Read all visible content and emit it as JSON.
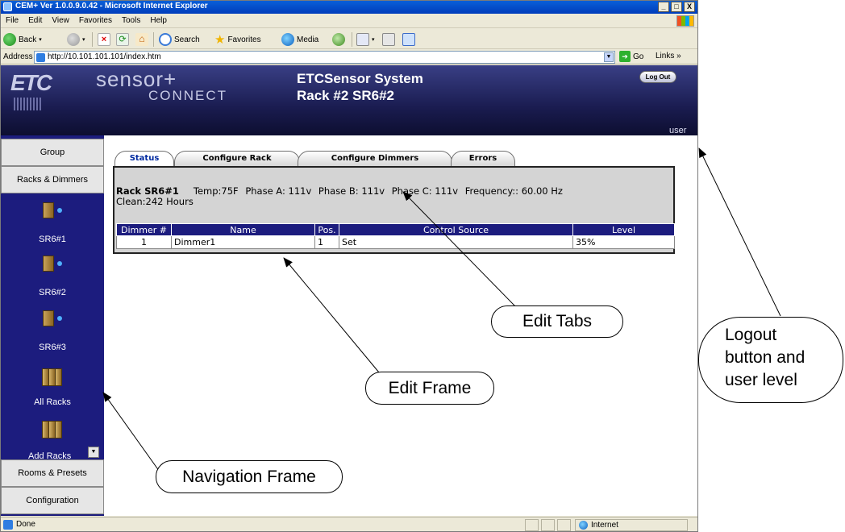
{
  "window": {
    "title": "CEM+ Ver 1.0.0.9.0.42 - Microsoft Internet Explorer",
    "min": "_",
    "max": "□",
    "close": "X"
  },
  "menu": [
    "File",
    "Edit",
    "View",
    "Favorites",
    "Tools",
    "Help"
  ],
  "toolbar": {
    "back": "Back",
    "search": "Search",
    "favorites": "Favorites",
    "media": "Media"
  },
  "address": {
    "label": "Address",
    "url": "http://10.101.101.101/index.htm",
    "go": "Go",
    "links": "Links"
  },
  "header": {
    "brand_main": "sensor+",
    "brand_sub": "CONNECT",
    "system_title": "ETCSensor System",
    "rack_title": "Rack #2 SR6#2",
    "logout": "Log Out",
    "user": "user"
  },
  "nav": {
    "group": "Group",
    "racks_dimmers": "Racks & Dimmers",
    "racks": [
      "SR6#1",
      "SR6#2",
      "SR6#3"
    ],
    "all_racks": "All Racks",
    "add_racks": "Add Racks",
    "rooms_presets": "Rooms & Presets",
    "configuration": "Configuration"
  },
  "tabs": [
    "Status",
    "Configure Rack",
    "Configure Dimmers",
    "Errors"
  ],
  "rack_info": {
    "name": "Rack SR6#1",
    "temp": "Temp:75F",
    "phase_a": "Phase A: 111v",
    "phase_b": "Phase B: 111v",
    "phase_c": "Phase C: 111v",
    "frequency": "Frequency:: 60.00 Hz",
    "clean": "Clean:242 Hours"
  },
  "table": {
    "headers": [
      "Dimmer #",
      "Name",
      "Pos.",
      "Control Source",
      "Level"
    ],
    "rows": [
      [
        "1",
        "Dimmer1",
        "1",
        "Set",
        "35%"
      ]
    ]
  },
  "status": {
    "text": "Done",
    "zone": "Internet"
  },
  "callouts": {
    "edit_tabs": "Edit Tabs",
    "edit_frame": "Edit Frame",
    "navigation_frame": "Navigation Frame",
    "logout": [
      "Logout",
      "button and",
      "user level"
    ]
  }
}
